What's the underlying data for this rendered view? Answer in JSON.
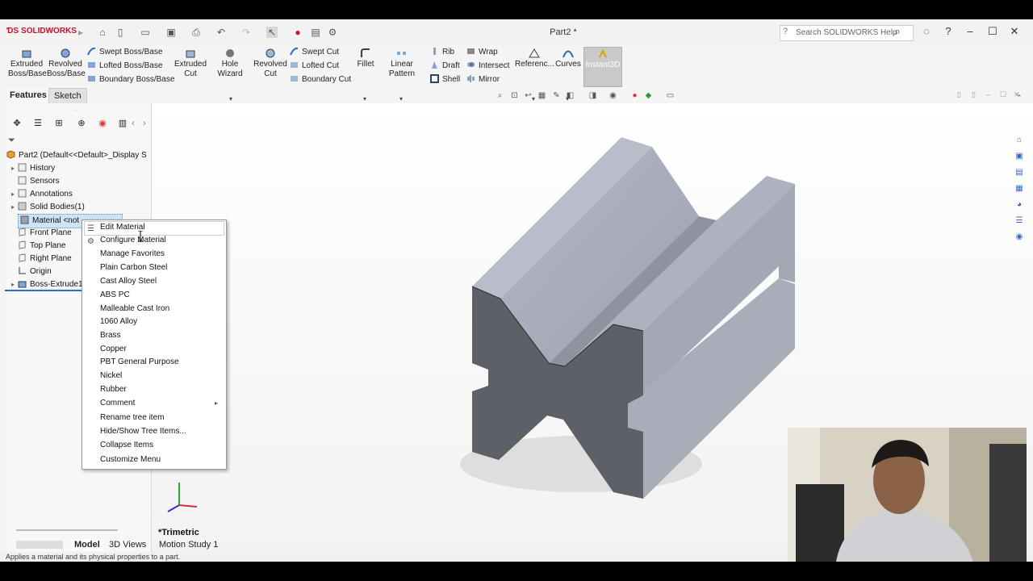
{
  "app": {
    "logo_text": "SOLIDWORKS",
    "document_title": "Part2 *",
    "search_placeholder": "Search SOLIDWORKS Help"
  },
  "ribbon": {
    "extruded_boss": "Extruded Boss/Base",
    "revolved_boss": "Revolved Boss/Base",
    "swept_boss": "Swept Boss/Base",
    "lofted_boss": "Lofted Boss/Base",
    "boundary_boss": "Boundary Boss/Base",
    "extruded_cut": "Extruded Cut",
    "hole_wizard": "Hole Wizard",
    "revolved_cut": "Revolved Cut",
    "swept_cut": "Swept Cut",
    "lofted_cut": "Lofted Cut",
    "boundary_cut": "Boundary Cut",
    "fillet": "Fillet",
    "linear_pattern": "Linear Pattern",
    "rib": "Rib",
    "draft": "Draft",
    "shell": "Shell",
    "wrap": "Wrap",
    "intersect": "Intersect",
    "mirror": "Mirror",
    "reference": "Referenc...",
    "curves": "Curves",
    "instant3d": "Instant3D"
  },
  "tabs": {
    "features": "Features",
    "sketch": "Sketch"
  },
  "tree": {
    "root": "Part2  (Default<<Default>_Display S",
    "items": [
      "History",
      "Sensors",
      "Annotations",
      "Solid Bodies(1)",
      "Material <not",
      "Front Plane",
      "Top Plane",
      "Right Plane",
      "Origin",
      "Boss-Extrude1"
    ]
  },
  "context_menu": {
    "items": [
      "Edit Material",
      "Configure Material",
      "Manage Favorites",
      "Plain Carbon Steel",
      "Cast Alloy Steel",
      "ABS PC",
      "Malleable Cast Iron",
      "1060 Alloy",
      "Brass",
      "Copper",
      "PBT General Purpose",
      "Nickel",
      "Rubber"
    ],
    "comment": "Comment",
    "bottom_items": [
      "Rename tree item",
      "Hide/Show Tree Items...",
      "Collapse Items",
      "Customize Menu"
    ]
  },
  "viewport": {
    "view_label": "*Trimetric"
  },
  "bottom_tabs": [
    "Model",
    "3D Views",
    "Motion Study 1"
  ],
  "status": {
    "text": "Applies a material and its physical properties to a part."
  },
  "colors": {
    "accent_red": "#c8102e",
    "selection_blue": "#cde3f7",
    "part_grey": "#5d6066"
  }
}
